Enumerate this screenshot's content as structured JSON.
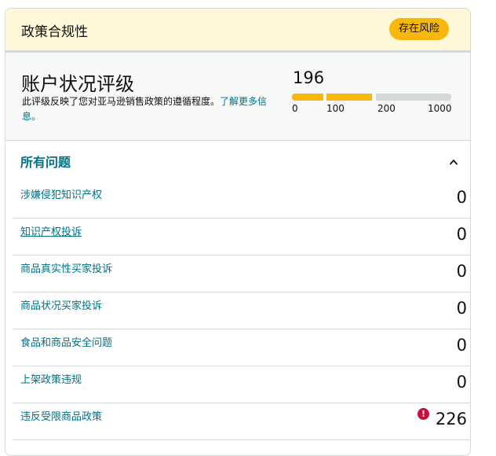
{
  "header": {
    "title": "政策合规性",
    "status_badge": "存在风险",
    "badge_color": "#f7b70c",
    "background_color": "#fef8d9"
  },
  "rating": {
    "title": "账户状况评级",
    "description": "此评级反映了您对亚马逊销售政策的遵循程度。",
    "learn_more": "了解更多信息。",
    "score": "196",
    "scale_ticks": [
      "0",
      "100",
      "200",
      "1000"
    ]
  },
  "issues": {
    "title": "所有问题",
    "collapse_icon": "chevron-up-icon",
    "rows": [
      {
        "label": "涉嫌侵犯知识产权",
        "value": "0"
      },
      {
        "label": "知识产权投诉",
        "value": "0"
      },
      {
        "label": "商品真实性买家投诉",
        "value": "0"
      },
      {
        "label": "商品状况买家投诉",
        "value": "0"
      },
      {
        "label": "食品和商品安全问题",
        "value": "0"
      },
      {
        "label": "上架政策违规",
        "value": "0"
      },
      {
        "label": "违反受限商品政策",
        "value": "226",
        "alert": "!"
      }
    ]
  },
  "colors": {
    "link": "#007185",
    "alert": "#cc0c39",
    "divider": "#d5d9d9"
  }
}
